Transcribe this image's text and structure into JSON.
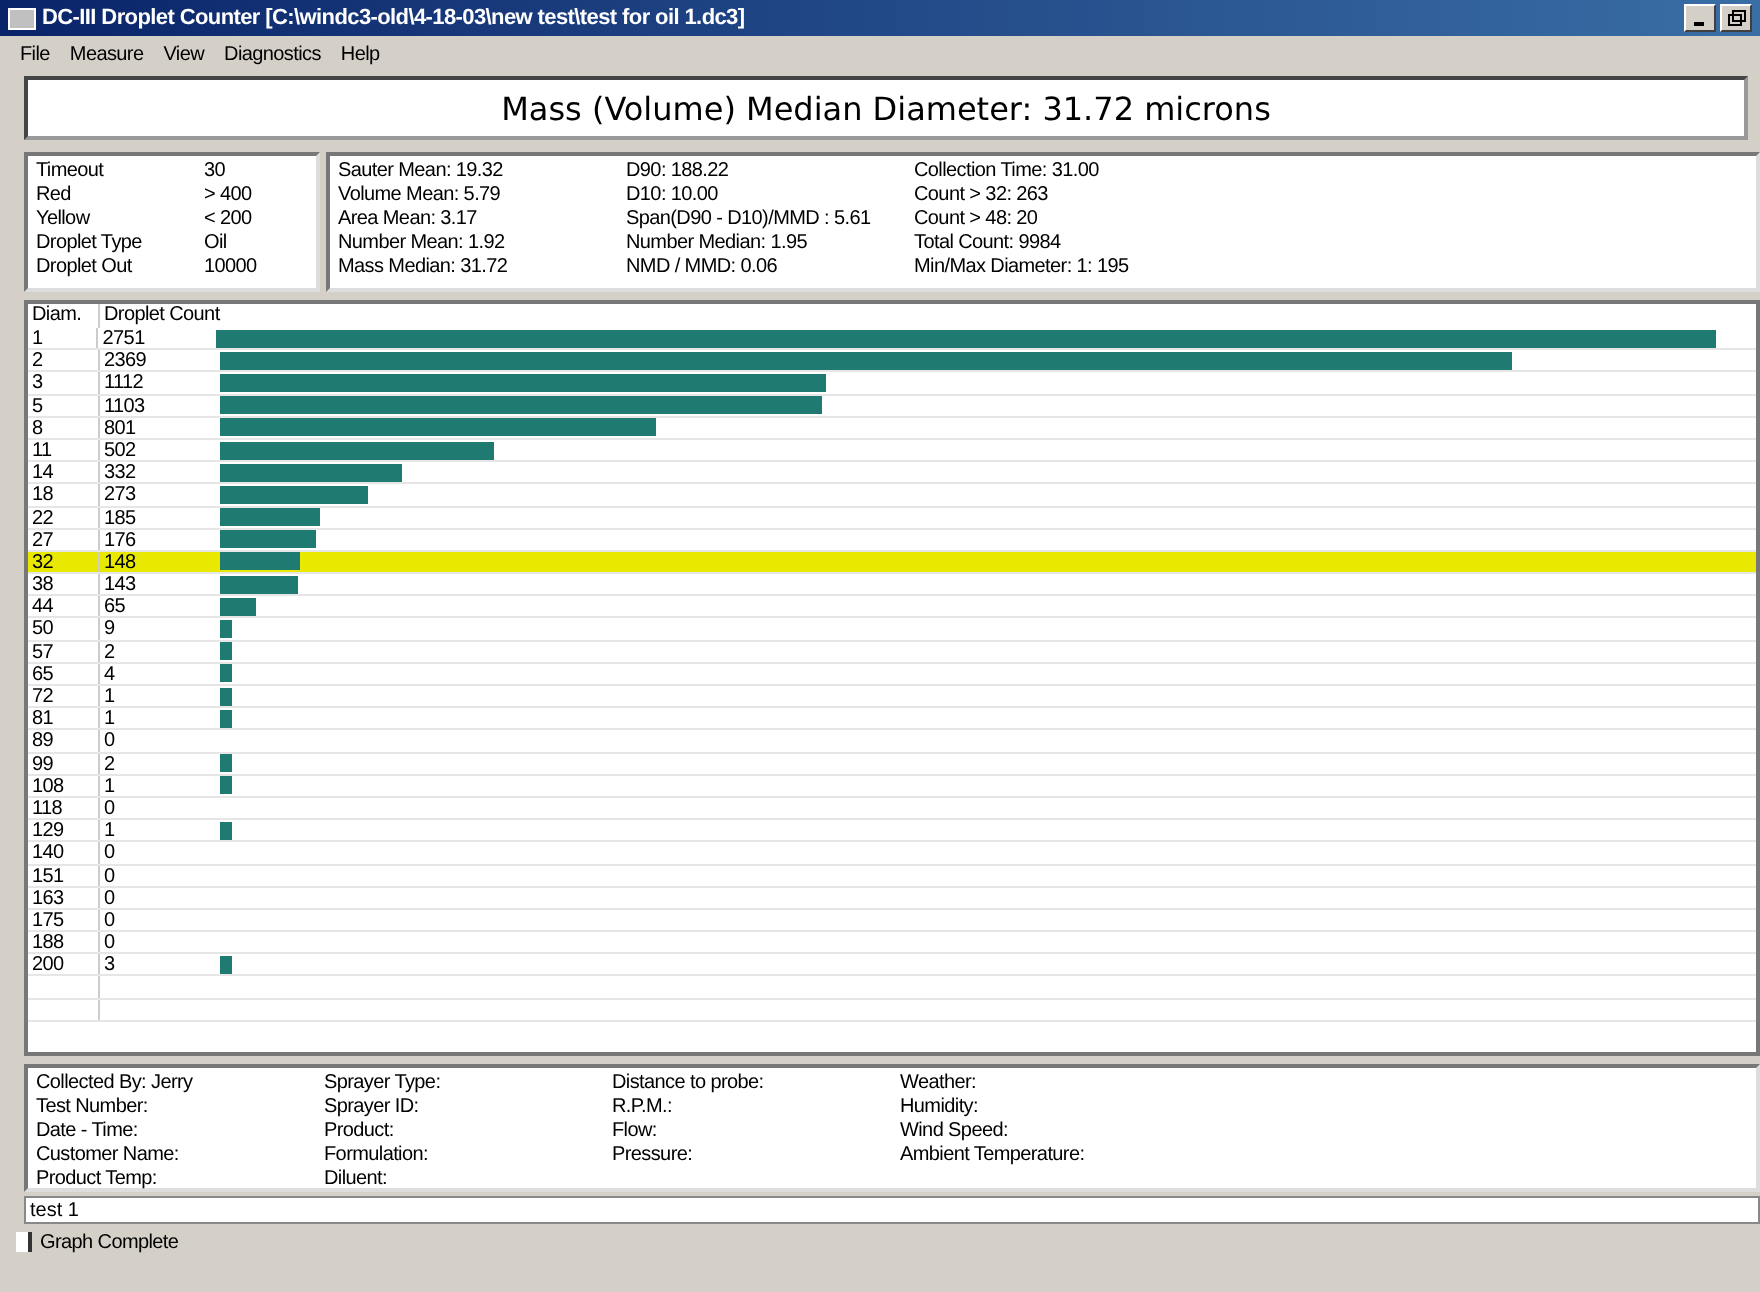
{
  "window": {
    "title": "DC-III Droplet Counter [C:\\windc3-old\\4-18-03\\new test\\test for oil 1.dc3]"
  },
  "menu": [
    "File",
    "Measure",
    "View",
    "Diagnostics",
    "Help"
  ],
  "heading": "Mass (Volume) Median Diameter: 31.72 microns",
  "settings": [
    {
      "label": "Timeout",
      "value": "30"
    },
    {
      "label": "Red",
      "value": "> 400"
    },
    {
      "label": "Yellow",
      "value": "< 200"
    },
    {
      "label": "Droplet Type",
      "value": "Oil"
    },
    {
      "label": "Droplet Out",
      "value": "10000"
    }
  ],
  "statistics": [
    [
      "Sauter Mean: 19.32",
      "Volume Mean: 5.79",
      "Area Mean: 3.17",
      "Number Mean: 1.92",
      "Mass Median: 31.72"
    ],
    [
      "D90: 188.22",
      "D10: 10.00",
      "Span(D90 - D10)/MMD : 5.61",
      "Number Median: 1.95",
      "NMD / MMD: 0.06"
    ],
    [
      "Collection Time: 31.00",
      "Count > 32: 263",
      "Count > 48: 20",
      "Total Count: 9984",
      "Min/Max Diameter: 1: 195"
    ]
  ],
  "table": {
    "columns": [
      "Diam.",
      "Droplet Count"
    ],
    "rows": [
      {
        "diam": "1",
        "count": "2751",
        "selected": false
      },
      {
        "diam": "2",
        "count": "2369",
        "selected": false
      },
      {
        "diam": "3",
        "count": "1112",
        "selected": false
      },
      {
        "diam": "5",
        "count": "1103",
        "selected": false
      },
      {
        "diam": "8",
        "count": "801",
        "selected": false
      },
      {
        "diam": "11",
        "count": "502",
        "selected": false
      },
      {
        "diam": "14",
        "count": "332",
        "selected": false
      },
      {
        "diam": "18",
        "count": "273",
        "selected": false
      },
      {
        "diam": "22",
        "count": "185",
        "selected": false
      },
      {
        "diam": "27",
        "count": "176",
        "selected": false
      },
      {
        "diam": "32",
        "count": "148",
        "selected": true
      },
      {
        "diam": "38",
        "count": "143",
        "selected": false
      },
      {
        "diam": "44",
        "count": "65",
        "selected": false
      },
      {
        "diam": "50",
        "count": "9",
        "selected": false
      },
      {
        "diam": "57",
        "count": "2",
        "selected": false
      },
      {
        "diam": "65",
        "count": "4",
        "selected": false
      },
      {
        "diam": "72",
        "count": "1",
        "selected": false
      },
      {
        "diam": "81",
        "count": "1",
        "selected": false
      },
      {
        "diam": "89",
        "count": "0",
        "selected": false
      },
      {
        "diam": "99",
        "count": "2",
        "selected": false
      },
      {
        "diam": "108",
        "count": "1",
        "selected": false
      },
      {
        "diam": "118",
        "count": "0",
        "selected": false
      },
      {
        "diam": "129",
        "count": "1",
        "selected": false
      },
      {
        "diam": "140",
        "count": "0",
        "selected": false
      },
      {
        "diam": "151",
        "count": "0",
        "selected": false
      },
      {
        "diam": "163",
        "count": "0",
        "selected": false
      },
      {
        "diam": "175",
        "count": "0",
        "selected": false
      },
      {
        "diam": "188",
        "count": "0",
        "selected": false
      },
      {
        "diam": "200",
        "count": "3",
        "selected": false
      }
    ]
  },
  "details": [
    [
      "Collected By: Jerry",
      "Test Number:",
      "Date - Time:",
      "Customer Name:",
      "Product Temp:"
    ],
    [
      "Sprayer Type:",
      "Sprayer ID:",
      "Product:",
      "Formulation:",
      "Diluent:"
    ],
    [
      "Distance to probe:",
      "R.P.M.:",
      "Flow:",
      "Pressure:"
    ],
    [
      "Weather:",
      "Humidity:",
      "Wind Speed:",
      "Ambient Temperature:"
    ]
  ],
  "comment": {
    "value": "test 1"
  },
  "status_bar": "Graph Complete"
}
